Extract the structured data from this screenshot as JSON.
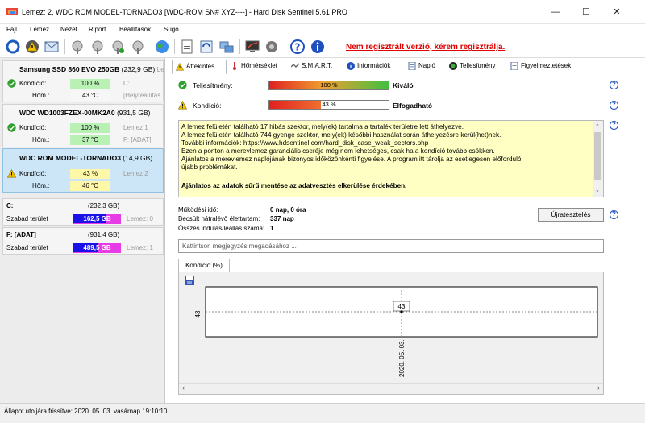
{
  "window": {
    "title": "Lemez: 2, WDC ROM MODEL-TORNADO3 [WDC-ROM SN# XYZ----]  -  Hard Disk Sentinel 5.61 PRO",
    "minimize": "—",
    "maximize": "☐",
    "close": "✕"
  },
  "menu": [
    {
      "label": "Fájl"
    },
    {
      "label": "Lemez"
    },
    {
      "label": "Nézet"
    },
    {
      "label": "Riport"
    },
    {
      "label": "Beállítások"
    },
    {
      "label": "Súgó"
    }
  ],
  "toolbar": {
    "register_link": "Nem regisztrált verzió, kérem regisztrálja."
  },
  "disks": [
    {
      "title": "Samsung SSD 860 EVO 250GB",
      "size": "(232,9 GB)",
      "extra": "Le",
      "status": "ok",
      "kondicio_label": "Kondíció:",
      "kondicio_value": "100 %",
      "kondicio_extra": "C:",
      "hom_label": "Hőm.:",
      "hom_value": "43 °C",
      "hom_extra": "[Helyreállítás"
    },
    {
      "title": "WDC WD1003FZEX-00MK2A0",
      "size": "(931,5 GB)",
      "status": "ok",
      "kondicio_label": "Kondíció:",
      "kondicio_value": "100 %",
      "kondicio_extra": "Lemez 1",
      "hom_label": "Hőm.:",
      "hom_value": "37 °C",
      "hom_extra": "F: [ADAT]"
    },
    {
      "title": "WDC ROM MODEL-TORNADO3",
      "size": "(14,9 GB)",
      "status": "warning",
      "kondicio_label": "Kondíció:",
      "kondicio_value": "43 %",
      "kondicio_extra": "Lemez 2",
      "hom_label": "Hőm.:",
      "hom_value": "46 °C",
      "hom_extra": ""
    }
  ],
  "volumes": [
    {
      "name": "C:",
      "size": "(232,3 GB)",
      "free_label": "Szabad terület",
      "free_value": "162,5 GB",
      "disk": "Lemez: 0",
      "free_fraction": 0.7
    },
    {
      "name": "F: [ADAT]",
      "size": "(931,4 GB)",
      "free_label": "Szabad terület",
      "free_value": "489,5 GB",
      "disk": "Lemez: 1",
      "free_fraction": 0.53
    }
  ],
  "tabs": [
    {
      "label": "Áttekintés",
      "icon": "warning-icon"
    },
    {
      "label": "Hőmérséklet",
      "icon": "thermometer-icon"
    },
    {
      "label": "S.M.A.R.T.",
      "icon": "smart-icon"
    },
    {
      "label": "Információk",
      "icon": "info-icon"
    },
    {
      "label": "Napló",
      "icon": "log-icon"
    },
    {
      "label": "Teljesítmény",
      "icon": "performance-icon"
    },
    {
      "label": "Figyelmeztetések",
      "icon": "alerts-icon"
    }
  ],
  "overview": {
    "performance_label": "Teljesítmény:",
    "performance_value": "100 %",
    "performance_fraction": 1.0,
    "performance_grade": "Kiváló",
    "health_label": "Kondíció:",
    "health_value": "43 %",
    "health_fraction": 0.43,
    "health_grade": "Elfogadható",
    "help": "?"
  },
  "message": {
    "lines": [
      "A lemez felületén található 17 hibás szektor, mely(ek) tartalma a tartalék területre lett áthelyezve.",
      "A lemez felületén található 744 gyenge szektor, mely(ek) későbbi használat során áthelyezésre kerül(het)nek.",
      "További információk: https://www.hdsentinel.com/hard_disk_case_weak_sectors.php",
      "Ezen a ponton a merevlemez garanciális cseréje még nem lehetséges, csak ha a kondíció tovább csökken.",
      "Ajánlatos a merevlemez naplójának bizonyos időközönkénti figyelése. A program itt tárolja az esetlegesen előforduló",
      "újabb problémákat."
    ],
    "bold_line": "Ajánlatos az adatok sűrű mentése az adatvesztés elkerülése érdekében."
  },
  "stats": {
    "uptime_label": "Működési idő:",
    "uptime_value": "0 nap, 0 óra",
    "remaining_label": "Becsült hátralévő élettartam:",
    "remaining_value": "337 nap",
    "starts_label": "Összes indulás/leállás száma:",
    "starts_value": "1",
    "retest_button": "Újratesztelés"
  },
  "comment": {
    "placeholder": "Kattintson megjegyzés megadásához ..."
  },
  "chart_tab": "Kondíció  (%)",
  "chart_data": {
    "type": "line",
    "x": [
      "2020. 05. 03."
    ],
    "series": [
      {
        "values": [
          43
        ]
      }
    ],
    "ytick": "43",
    "xtick": "2020. 05. 03.",
    "point_label": "43"
  },
  "statusbar": "Állapot utoljára frissítve: 2020. 05. 03. vasárnap 19:10:10",
  "colors": {
    "ok": "#2e9e2e",
    "warning": "#f2c200",
    "accent_link": "#e00000",
    "free_bar_c": "#1a10e8",
    "free_bar_f": "#1a10e8"
  }
}
